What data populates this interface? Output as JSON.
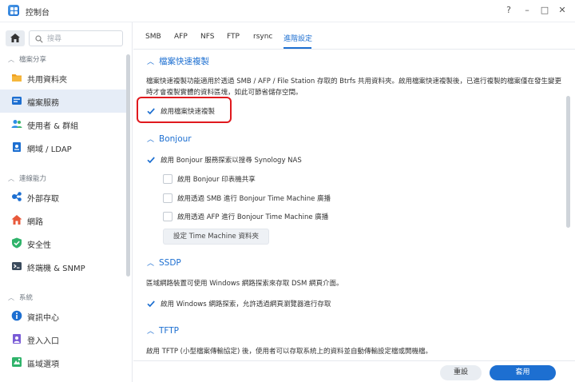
{
  "window": {
    "title": "控制台",
    "help": "?",
    "minimize": "–",
    "maximize": "□",
    "close": "✕"
  },
  "sidebar": {
    "search_placeholder": "搜尋",
    "sections": [
      {
        "title": "檔案分享",
        "items": [
          "共用資料夾",
          "檔案服務",
          "使用者 & 群組",
          "網域 / LDAP"
        ]
      },
      {
        "title": "連線能力",
        "items": [
          "外部存取",
          "網路",
          "安全性",
          "終端機 & SNMP"
        ]
      },
      {
        "title": "系統",
        "items": [
          "資訊中心",
          "登入入口",
          "區域選項"
        ]
      }
    ],
    "active_item": "檔案服務"
  },
  "tabs": [
    "SMB",
    "AFP",
    "NFS",
    "FTP",
    "rsync",
    "進階設定"
  ],
  "active_tab": "進階設定",
  "groups": {
    "fastclone": {
      "title": "檔案快速複製",
      "description": "檔案快速複製功能適用於透過 SMB / AFP / File Station 存取的 Btrfs 共用資料夾。啟用檔案快速複製後，已進行複製的檔案僅在發生變更時才會複製實體的資料區塊，如此可節省儲存空間。",
      "enable_label": "啟用檔案快速複製",
      "enabled": true
    },
    "bonjour": {
      "title": "Bonjour",
      "enable_label": "啟用 Bonjour 服務探索以搜尋 Synology NAS",
      "printer_label": "啟用 Bonjour 印表機共享",
      "smb_tm_label": "啟用透過 SMB 進行 Bonjour Time Machine 廣播",
      "afp_tm_label": "啟用透過 AFP 進行 Bonjour Time Machine 廣播",
      "tm_button": "設定 Time Machine 資料夾"
    },
    "ssdp": {
      "title": "SSDP",
      "description": "區域網路裝置可使用 Windows 網路探索來存取 DSM 網頁介面。",
      "enable_label": "啟用 Windows 網路探索，允許透過網頁瀏覽器進行存取"
    },
    "tftp": {
      "title": "TFTP",
      "description": "啟用 TFTP (小型檔案傳輸協定) 後，使用者可以存取系統上的資料並自動傳輸設定檔或開機檔。"
    }
  },
  "footer": {
    "reset": "重設",
    "apply": "套用"
  },
  "colors": {
    "accent": "#1d6fd1",
    "highlight": "#e0191e"
  }
}
